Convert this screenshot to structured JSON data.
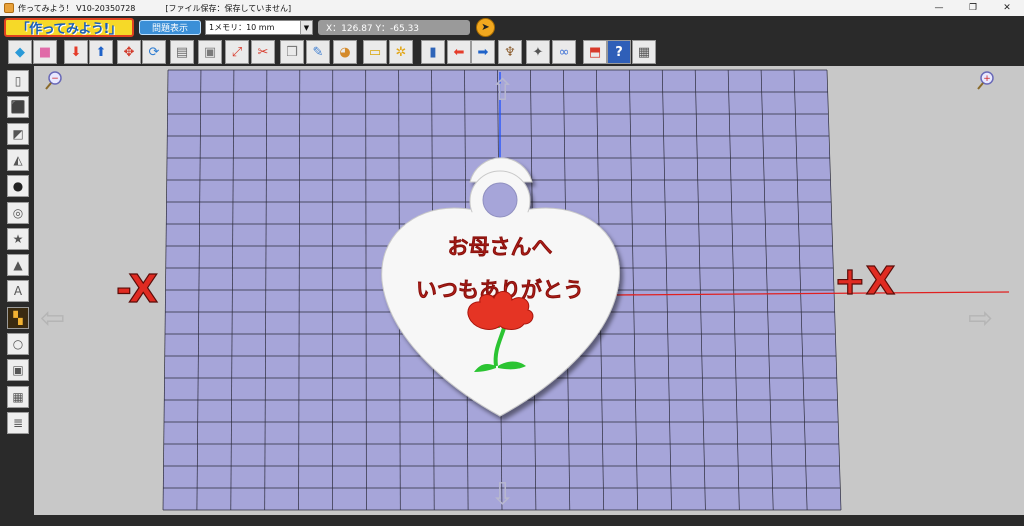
{
  "window": {
    "title": "作ってみよう！ V10-20350728",
    "save_status": "[ファイル保存：保存していません]",
    "minimize_glyph": "—",
    "maximize_glyph": "❐",
    "close_glyph": "✕"
  },
  "toolbar_top": {
    "logo_text": "「作ってみよう!」",
    "question_button_label": "問題表示",
    "scale_select_value": "1メモリ：10 mm",
    "coordinate_readout": "X：126.87   Y：-65.33"
  },
  "toolbar_icons": [
    {
      "name": "new-cube-icon",
      "glyph": "◆",
      "color": "#2a9ad8"
    },
    {
      "name": "pink-cube-icon",
      "glyph": "■",
      "color": "#e06aa8"
    },
    {
      "name": "import-down-icon",
      "glyph": "⬇",
      "color": "#e53c2a"
    },
    {
      "name": "export-up-icon",
      "glyph": "⬆",
      "color": "#1f63c9"
    },
    {
      "name": "move-object-icon",
      "glyph": "✥",
      "color": "#d23b2b"
    },
    {
      "name": "rotate-icon",
      "glyph": "⟳",
      "color": "#2d7cd1"
    },
    {
      "name": "layer-icon",
      "glyph": "▤",
      "color": "#6d6d6d"
    },
    {
      "name": "group-icon",
      "glyph": "▣",
      "color": "#7a7a7a"
    },
    {
      "name": "scale-icon",
      "glyph": "⤢",
      "color": "#d83a2b"
    },
    {
      "name": "scissors-icon",
      "glyph": "✂",
      "color": "#d83a2b"
    },
    {
      "name": "copy-object-icon",
      "glyph": "❒",
      "color": "#7a7a7a"
    },
    {
      "name": "comment-icon",
      "glyph": "✎",
      "color": "#3f7fd1"
    },
    {
      "name": "palette-icon",
      "glyph": "◕",
      "color": "#d48a2a"
    },
    {
      "name": "ruler-icon",
      "glyph": "▭",
      "color": "#d9a60a"
    },
    {
      "name": "gear-icon",
      "glyph": "✲",
      "color": "#e2a514"
    },
    {
      "name": "door-icon",
      "glyph": "▮",
      "color": "#2e64b8"
    },
    {
      "name": "undo-arrow-icon",
      "glyph": "⬅",
      "color": "#e53c2a"
    },
    {
      "name": "redo-arrow-icon",
      "glyph": "➡",
      "color": "#1f63c9"
    },
    {
      "name": "brush-icon",
      "glyph": "♆",
      "color": "#8a5a2a"
    },
    {
      "name": "walk-icon",
      "glyph": "✦",
      "color": "#555555"
    },
    {
      "name": "view-glasses-icon",
      "glyph": "∞",
      "color": "#3a6fd6"
    },
    {
      "name": "export-box-icon",
      "glyph": "⬒",
      "color": "#d83a2b"
    },
    {
      "name": "help-icon",
      "glyph": "?",
      "color": "#ffffff"
    },
    {
      "name": "calculator-icon",
      "glyph": "▦",
      "color": "#555555"
    }
  ],
  "left_toolbar": [
    {
      "name": "cylinder-shape-icon",
      "glyph": "▯"
    },
    {
      "name": "cube-shape-icon",
      "glyph": "⬛"
    },
    {
      "name": "wedge-shape-icon",
      "glyph": "◩"
    },
    {
      "name": "pyramid-shape-icon",
      "glyph": "◭"
    },
    {
      "name": "sphere-shape-icon",
      "glyph": "●"
    },
    {
      "name": "tube-shape-icon",
      "glyph": "◎"
    },
    {
      "name": "star-shape-icon",
      "glyph": "★"
    },
    {
      "name": "cone-shape-icon",
      "glyph": "▲"
    },
    {
      "name": "text-shape-icon",
      "glyph": "A"
    },
    {
      "name": "pattern-shape-icon",
      "glyph": "▚"
    },
    {
      "name": "ring-shape-icon",
      "glyph": "○"
    },
    {
      "name": "box-shape-icon",
      "glyph": "▣"
    },
    {
      "name": "stack-shape-icon",
      "glyph": "▦"
    },
    {
      "name": "spring-shape-icon",
      "glyph": "≣"
    }
  ],
  "viewport": {
    "minus_x_label": "-X",
    "plus_x_label": "+X",
    "zoom_out_glyph": "−",
    "zoom_in_glyph": "+",
    "keychain_line1": "お母さんへ",
    "keychain_line2": "いつもありがとう",
    "grid_color": "#a6a5d9",
    "text_color": "#d22a22",
    "flower_color": "#e53424",
    "stem_color": "#2bc432"
  }
}
